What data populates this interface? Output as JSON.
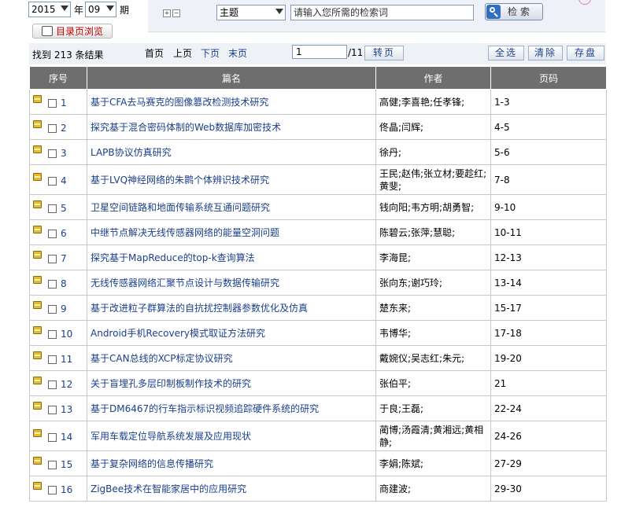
{
  "filters": {
    "year": "2015",
    "year_unit": "年",
    "month": "09",
    "issue_unit": "期",
    "toc_browse_label": "目录页浏览"
  },
  "search": {
    "field": "主题",
    "keyword_placeholder": "请输入您所需的检索词",
    "button_label": "检索"
  },
  "results": {
    "summary": "找到 213 条结果",
    "first": "首页",
    "prev": "上页",
    "next": "下页",
    "last": "末页",
    "page_value": "1",
    "page_total": "/11",
    "jump_label": "转页",
    "select_all": "全选",
    "clear": "清除",
    "save": "存盘"
  },
  "table": {
    "headers": [
      "序号",
      "篇名",
      "作者",
      "页码"
    ],
    "rows": [
      {
        "no": "1",
        "title": "基于CFA去马赛克的图像篡改检测技术研究",
        "authors": "高健;李喜艳;任孝锋;",
        "pages": "1-3"
      },
      {
        "no": "2",
        "title": "探究基于混合密码体制的Web数据库加密技术",
        "authors": "佟晶;闫辉;",
        "pages": "4-5"
      },
      {
        "no": "3",
        "title": "LAPB协议仿真研究",
        "authors": "徐丹;",
        "pages": "5-6"
      },
      {
        "no": "4",
        "title": "基于LVQ神经网络的朱鹮个体辨识技术研究",
        "authors": "王民;赵伟;张立材;要趁红;黄斐;",
        "pages": "7-8"
      },
      {
        "no": "5",
        "title": "卫星空间链路和地面传输系统互通问题研究",
        "authors": "钱向阳;韦方明;胡勇智;",
        "pages": "9-10"
      },
      {
        "no": "6",
        "title": "中继节点解决无线传感器网络的能量空洞问题",
        "authors": "陈碧云;张萍;慧聪;",
        "pages": "10-11"
      },
      {
        "no": "7",
        "title": "探究基于MapReduce的top-k查询算法",
        "authors": "李海昆;",
        "pages": "12-13"
      },
      {
        "no": "8",
        "title": "无线传感器网络汇聚节点设计与数据传输研究",
        "authors": "张向东;谢巧玲;",
        "pages": "13-14"
      },
      {
        "no": "9",
        "title": "基于改进粒子群算法的自抗扰控制器参数优化及仿真",
        "authors": "楚东来;",
        "pages": "15-17"
      },
      {
        "no": "10",
        "title": "Android手机Recovery模式取证方法研究",
        "authors": "韦博华;",
        "pages": "17-18"
      },
      {
        "no": "11",
        "title": "基于CAN总线的XCP标定协议研究",
        "authors": "戴婉仪;吴志红;朱元;",
        "pages": "19-20"
      },
      {
        "no": "12",
        "title": "关于盲埋孔多层印制板制作技术的研究",
        "authors": "张伯平;",
        "pages": "21"
      },
      {
        "no": "13",
        "title": "基于DM6467的行车指示标识视频追踪硬件系统的研究",
        "authors": "于良;王磊;",
        "pages": "22-24"
      },
      {
        "no": "14",
        "title": "军用车载定位导航系统发展及应用现状",
        "authors": "蔺博;汤霞清;黄湘远;黄相静;",
        "pages": "24-26"
      },
      {
        "no": "15",
        "title": "基于复杂网络的信息传播研究",
        "authors": "李娟;陈斌;",
        "pages": "27-29"
      },
      {
        "no": "16",
        "title": "ZigBee技术在智能家居中的应用研究",
        "authors": "商建波;",
        "pages": "29-30"
      }
    ]
  }
}
